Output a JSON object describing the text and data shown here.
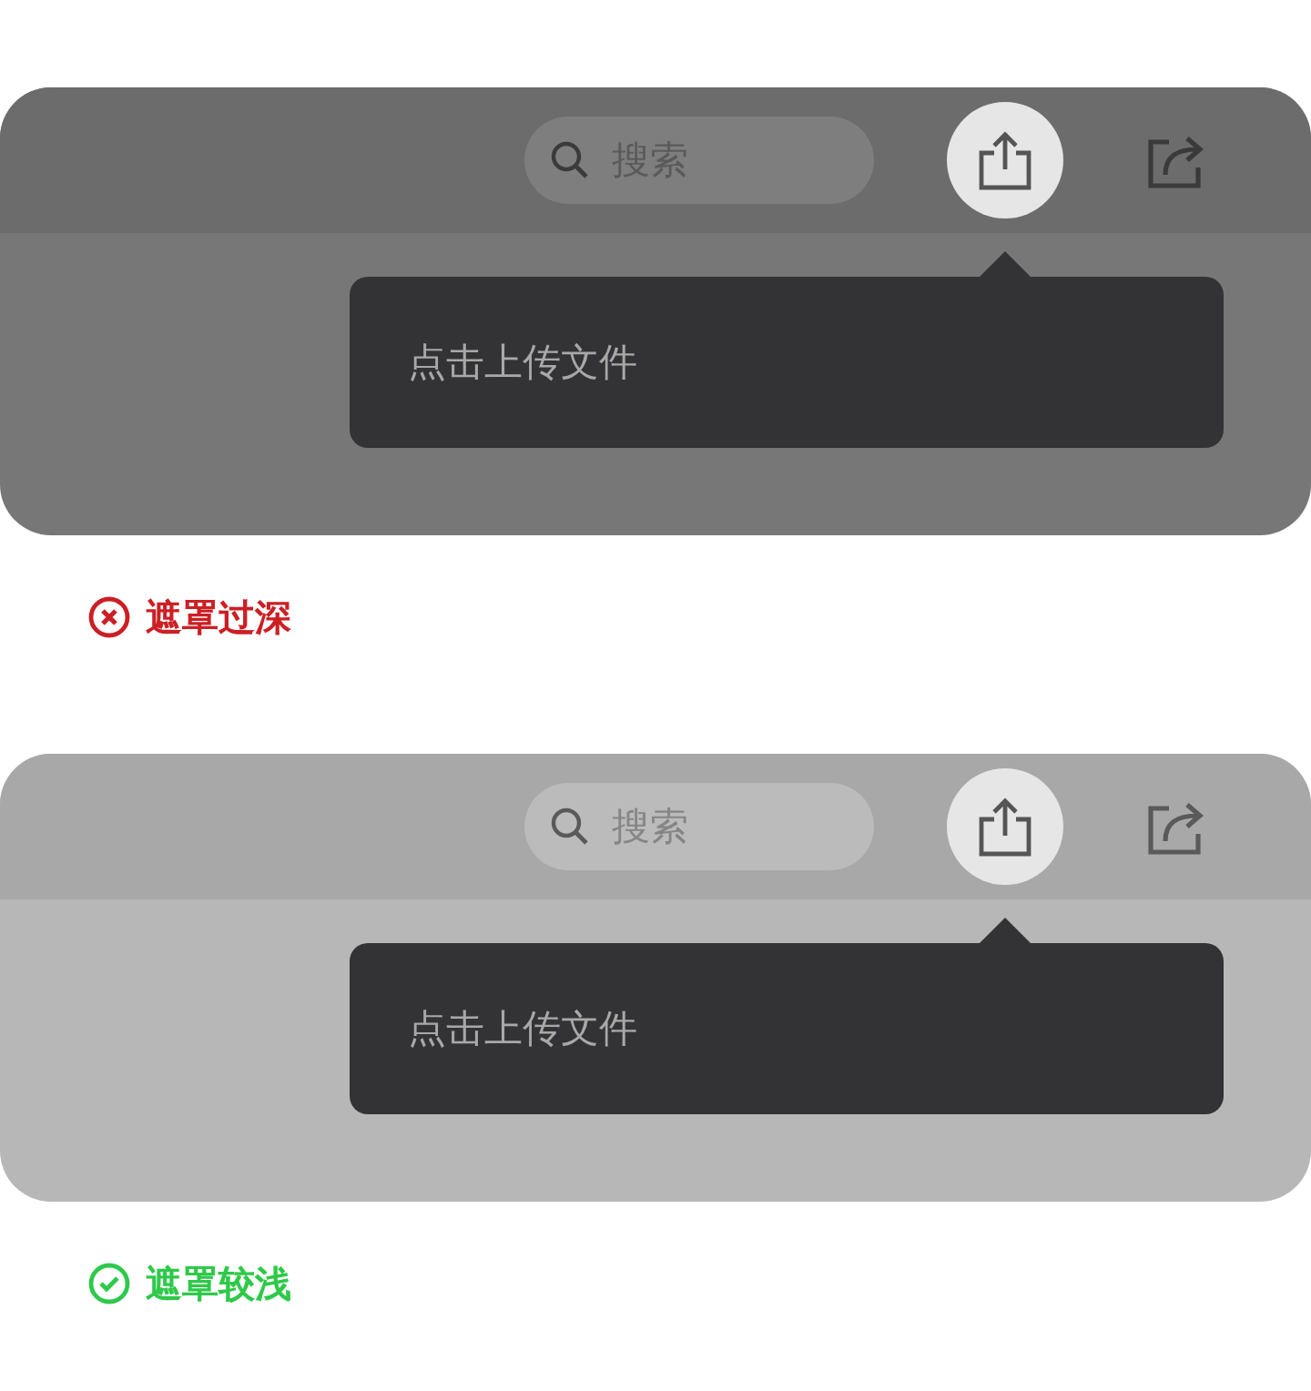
{
  "examples": [
    {
      "kind": "bad",
      "search": {
        "placeholder": "搜索"
      },
      "tooltip": "点击上传文件",
      "caption": "遮罩过深"
    },
    {
      "kind": "good",
      "search": {
        "placeholder": "搜索"
      },
      "tooltip": "点击上传文件",
      "caption": "遮罩较浅"
    }
  ]
}
